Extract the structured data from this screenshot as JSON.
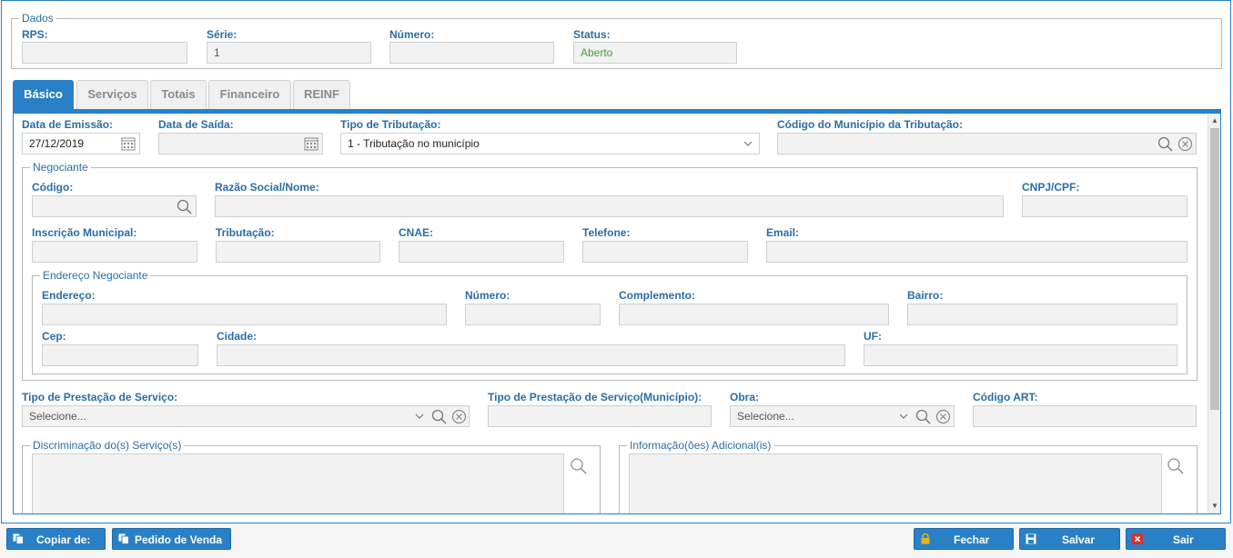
{
  "dados": {
    "legend": "Dados",
    "rps_label": "RPS:",
    "rps_value": "",
    "serie_label": "Série:",
    "serie_value": "1",
    "numero_label": "Número:",
    "numero_value": "",
    "status_label": "Status:",
    "status_value": "Aberto"
  },
  "tabs": [
    {
      "label": "Básico",
      "active": true
    },
    {
      "label": "Serviços",
      "active": false
    },
    {
      "label": "Totais",
      "active": false
    },
    {
      "label": "Financeiro",
      "active": false
    },
    {
      "label": "REINF",
      "active": false
    }
  ],
  "basico": {
    "data_emissao_label": "Data de Emissão:",
    "data_emissao_value": "27/12/2019",
    "data_saida_label": "Data de Saída:",
    "data_saida_value": "",
    "tipo_tributacao_label": "Tipo de Tributação:",
    "tipo_tributacao_value": "1 - Tributação no município",
    "codigo_municipio_label": "Código do Município da Tributação:",
    "codigo_municipio_value": ""
  },
  "negociante": {
    "legend": "Negociante",
    "codigo_label": "Código:",
    "razao_label": "Razão Social/Nome:",
    "cnpj_label": "CNPJ/CPF:",
    "inscricao_label": "Inscrição Municipal:",
    "tributacao_label": "Tributação:",
    "cnae_label": "CNAE:",
    "telefone_label": "Telefone:",
    "email_label": "Email:"
  },
  "endereco": {
    "legend": "Endereço Negociante",
    "endereco_label": "Endereço:",
    "numero_label": "Número:",
    "complemento_label": "Complemento:",
    "bairro_label": "Bairro:",
    "cep_label": "Cep:",
    "cidade_label": "Cidade:",
    "uf_label": "UF:"
  },
  "servico": {
    "tipo_prestacao_label": "Tipo de Prestação de Serviço:",
    "tipo_prestacao_placeholder": "Selecione...",
    "tipo_prestacao_mun_label": "Tipo de Prestação de Serviço(Município):",
    "obra_label": "Obra:",
    "obra_placeholder": "Selecione...",
    "codigo_art_label": "Código ART:",
    "discriminacao_legend": "Discriminação do(s) Serviço(s)",
    "informacao_legend": "Informação(ões) Adicional(is)"
  },
  "buttons": {
    "copiar": "Copiar de:",
    "pedido": "Pedido de Venda",
    "fechar": "Fechar",
    "salvar": "Salvar",
    "sair": "Sair"
  },
  "colors": {
    "accent": "#2a80c6",
    "label": "#2a6da5",
    "status_green": "#4a9a3c",
    "exit_icon": "#d9302b",
    "lock_icon": "#e8b21e"
  }
}
